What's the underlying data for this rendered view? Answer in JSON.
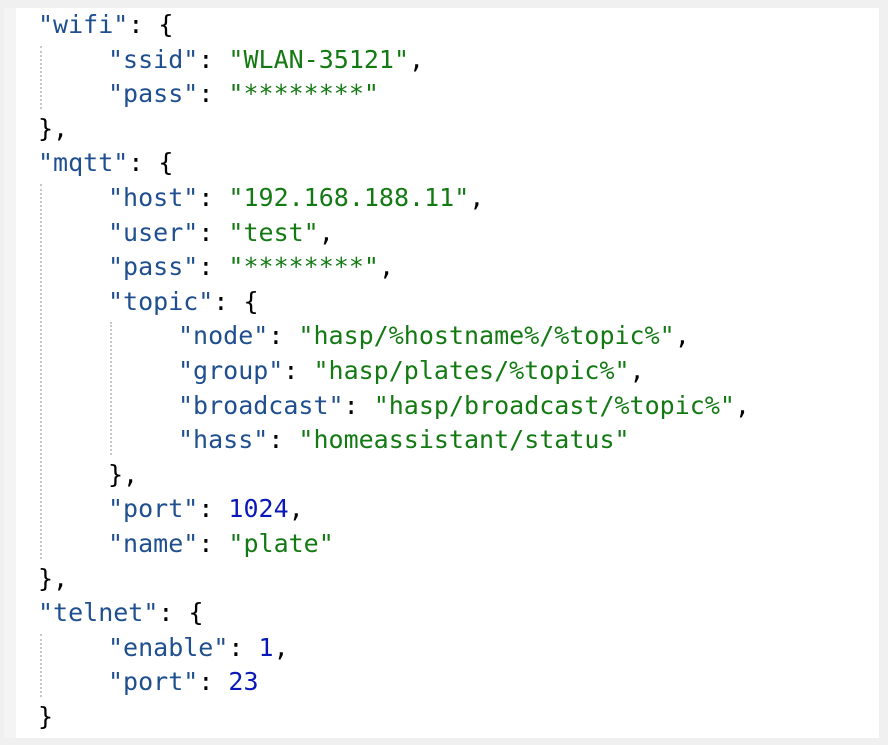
{
  "editor": {
    "lines": [
      {
        "indent": 0,
        "parts": [
          {
            "t": "key",
            "v": "\"wifi\""
          },
          {
            "t": "punc",
            "v": ": {"
          }
        ]
      },
      {
        "indent": 1,
        "parts": [
          {
            "t": "key",
            "v": "\"ssid\""
          },
          {
            "t": "punc",
            "v": ": "
          },
          {
            "t": "str",
            "v": "\"WLAN-35121\""
          },
          {
            "t": "punc",
            "v": ","
          }
        ]
      },
      {
        "indent": 1,
        "parts": [
          {
            "t": "key",
            "v": "\"pass\""
          },
          {
            "t": "punc",
            "v": ": "
          },
          {
            "t": "str",
            "v": "\"********\""
          }
        ]
      },
      {
        "indent": 0,
        "parts": [
          {
            "t": "punc",
            "v": "},"
          }
        ]
      },
      {
        "indent": 0,
        "parts": [
          {
            "t": "key",
            "v": "\"mqtt\""
          },
          {
            "t": "punc",
            "v": ": {"
          }
        ]
      },
      {
        "indent": 1,
        "parts": [
          {
            "t": "key",
            "v": "\"host\""
          },
          {
            "t": "punc",
            "v": ": "
          },
          {
            "t": "str",
            "v": "\"192.168.188.11\""
          },
          {
            "t": "punc",
            "v": ","
          }
        ]
      },
      {
        "indent": 1,
        "parts": [
          {
            "t": "key",
            "v": "\"user\""
          },
          {
            "t": "punc",
            "v": ": "
          },
          {
            "t": "str",
            "v": "\"test\""
          },
          {
            "t": "punc",
            "v": ","
          }
        ]
      },
      {
        "indent": 1,
        "parts": [
          {
            "t": "key",
            "v": "\"pass\""
          },
          {
            "t": "punc",
            "v": ": "
          },
          {
            "t": "str",
            "v": "\"********\""
          },
          {
            "t": "punc",
            "v": ","
          }
        ]
      },
      {
        "indent": 1,
        "parts": [
          {
            "t": "key",
            "v": "\"topic\""
          },
          {
            "t": "punc",
            "v": ": {"
          }
        ]
      },
      {
        "indent": 2,
        "parts": [
          {
            "t": "key",
            "v": "\"node\""
          },
          {
            "t": "punc",
            "v": ": "
          },
          {
            "t": "str",
            "v": "\"hasp/%hostname%/%topic%\""
          },
          {
            "t": "punc",
            "v": ","
          }
        ]
      },
      {
        "indent": 2,
        "parts": [
          {
            "t": "key",
            "v": "\"group\""
          },
          {
            "t": "punc",
            "v": ": "
          },
          {
            "t": "str",
            "v": "\"hasp/plates/%topic%\""
          },
          {
            "t": "punc",
            "v": ","
          }
        ]
      },
      {
        "indent": 2,
        "parts": [
          {
            "t": "key",
            "v": "\"broadcast\""
          },
          {
            "t": "punc",
            "v": ": "
          },
          {
            "t": "str",
            "v": "\"hasp/broadcast/%topic%\""
          },
          {
            "t": "punc",
            "v": ","
          }
        ]
      },
      {
        "indent": 2,
        "parts": [
          {
            "t": "key",
            "v": "\"hass\""
          },
          {
            "t": "punc",
            "v": ": "
          },
          {
            "t": "str",
            "v": "\"homeassistant/status\""
          }
        ]
      },
      {
        "indent": 1,
        "parts": [
          {
            "t": "punc",
            "v": "},"
          }
        ]
      },
      {
        "indent": 1,
        "parts": [
          {
            "t": "key",
            "v": "\"port\""
          },
          {
            "t": "punc",
            "v": ": "
          },
          {
            "t": "num",
            "v": "1024"
          },
          {
            "t": "punc",
            "v": ","
          }
        ]
      },
      {
        "indent": 1,
        "parts": [
          {
            "t": "key",
            "v": "\"name\""
          },
          {
            "t": "punc",
            "v": ": "
          },
          {
            "t": "str",
            "v": "\"plate\""
          }
        ]
      },
      {
        "indent": 0,
        "parts": [
          {
            "t": "punc",
            "v": "},"
          }
        ]
      },
      {
        "indent": 0,
        "parts": [
          {
            "t": "key",
            "v": "\"telnet\""
          },
          {
            "t": "punc",
            "v": ": {"
          }
        ]
      },
      {
        "indent": 1,
        "parts": [
          {
            "t": "key",
            "v": "\"enable\""
          },
          {
            "t": "punc",
            "v": ": "
          },
          {
            "t": "num",
            "v": "1"
          },
          {
            "t": "punc",
            "v": ","
          }
        ]
      },
      {
        "indent": 1,
        "parts": [
          {
            "t": "key",
            "v": "\"port\""
          },
          {
            "t": "punc",
            "v": ": "
          },
          {
            "t": "num",
            "v": "23"
          }
        ]
      },
      {
        "indent": 0,
        "parts": [
          {
            "t": "punc",
            "v": "}"
          }
        ]
      }
    ]
  },
  "colors": {
    "key": "#1f4f8f",
    "string": "#137a13",
    "number": "#0a18b8",
    "punctuation": "#000000"
  }
}
